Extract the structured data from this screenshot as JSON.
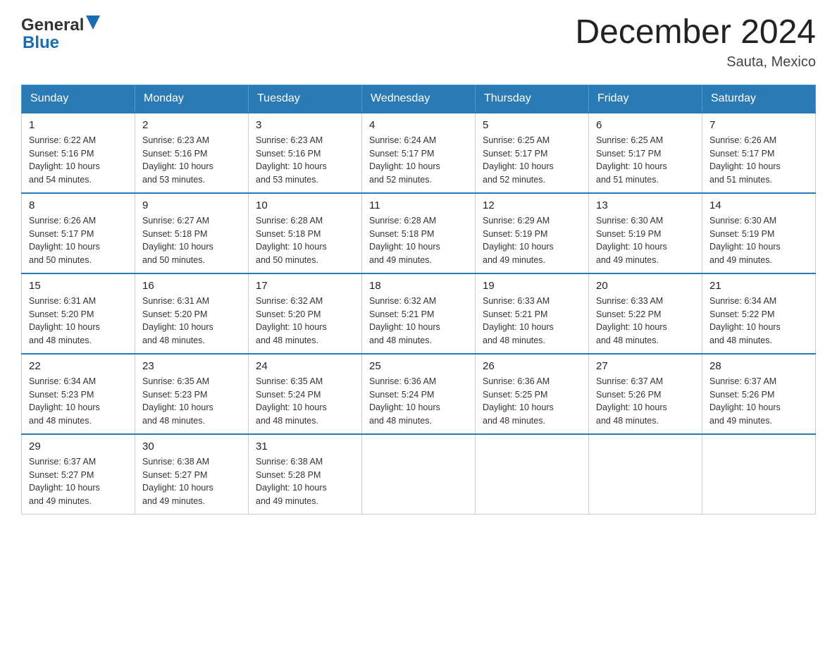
{
  "header": {
    "logo_general": "General",
    "logo_blue": "Blue",
    "title": "December 2024",
    "subtitle": "Sauta, Mexico"
  },
  "days_of_week": [
    "Sunday",
    "Monday",
    "Tuesday",
    "Wednesday",
    "Thursday",
    "Friday",
    "Saturday"
  ],
  "weeks": [
    [
      {
        "day": "1",
        "sunrise": "6:22 AM",
        "sunset": "5:16 PM",
        "daylight": "10 hours and 54 minutes."
      },
      {
        "day": "2",
        "sunrise": "6:23 AM",
        "sunset": "5:16 PM",
        "daylight": "10 hours and 53 minutes."
      },
      {
        "day": "3",
        "sunrise": "6:23 AM",
        "sunset": "5:16 PM",
        "daylight": "10 hours and 53 minutes."
      },
      {
        "day": "4",
        "sunrise": "6:24 AM",
        "sunset": "5:17 PM",
        "daylight": "10 hours and 52 minutes."
      },
      {
        "day": "5",
        "sunrise": "6:25 AM",
        "sunset": "5:17 PM",
        "daylight": "10 hours and 52 minutes."
      },
      {
        "day": "6",
        "sunrise": "6:25 AM",
        "sunset": "5:17 PM",
        "daylight": "10 hours and 51 minutes."
      },
      {
        "day": "7",
        "sunrise": "6:26 AM",
        "sunset": "5:17 PM",
        "daylight": "10 hours and 51 minutes."
      }
    ],
    [
      {
        "day": "8",
        "sunrise": "6:26 AM",
        "sunset": "5:17 PM",
        "daylight": "10 hours and 50 minutes."
      },
      {
        "day": "9",
        "sunrise": "6:27 AM",
        "sunset": "5:18 PM",
        "daylight": "10 hours and 50 minutes."
      },
      {
        "day": "10",
        "sunrise": "6:28 AM",
        "sunset": "5:18 PM",
        "daylight": "10 hours and 50 minutes."
      },
      {
        "day": "11",
        "sunrise": "6:28 AM",
        "sunset": "5:18 PM",
        "daylight": "10 hours and 49 minutes."
      },
      {
        "day": "12",
        "sunrise": "6:29 AM",
        "sunset": "5:19 PM",
        "daylight": "10 hours and 49 minutes."
      },
      {
        "day": "13",
        "sunrise": "6:30 AM",
        "sunset": "5:19 PM",
        "daylight": "10 hours and 49 minutes."
      },
      {
        "day": "14",
        "sunrise": "6:30 AM",
        "sunset": "5:19 PM",
        "daylight": "10 hours and 49 minutes."
      }
    ],
    [
      {
        "day": "15",
        "sunrise": "6:31 AM",
        "sunset": "5:20 PM",
        "daylight": "10 hours and 48 minutes."
      },
      {
        "day": "16",
        "sunrise": "6:31 AM",
        "sunset": "5:20 PM",
        "daylight": "10 hours and 48 minutes."
      },
      {
        "day": "17",
        "sunrise": "6:32 AM",
        "sunset": "5:20 PM",
        "daylight": "10 hours and 48 minutes."
      },
      {
        "day": "18",
        "sunrise": "6:32 AM",
        "sunset": "5:21 PM",
        "daylight": "10 hours and 48 minutes."
      },
      {
        "day": "19",
        "sunrise": "6:33 AM",
        "sunset": "5:21 PM",
        "daylight": "10 hours and 48 minutes."
      },
      {
        "day": "20",
        "sunrise": "6:33 AM",
        "sunset": "5:22 PM",
        "daylight": "10 hours and 48 minutes."
      },
      {
        "day": "21",
        "sunrise": "6:34 AM",
        "sunset": "5:22 PM",
        "daylight": "10 hours and 48 minutes."
      }
    ],
    [
      {
        "day": "22",
        "sunrise": "6:34 AM",
        "sunset": "5:23 PM",
        "daylight": "10 hours and 48 minutes."
      },
      {
        "day": "23",
        "sunrise": "6:35 AM",
        "sunset": "5:23 PM",
        "daylight": "10 hours and 48 minutes."
      },
      {
        "day": "24",
        "sunrise": "6:35 AM",
        "sunset": "5:24 PM",
        "daylight": "10 hours and 48 minutes."
      },
      {
        "day": "25",
        "sunrise": "6:36 AM",
        "sunset": "5:24 PM",
        "daylight": "10 hours and 48 minutes."
      },
      {
        "day": "26",
        "sunrise": "6:36 AM",
        "sunset": "5:25 PM",
        "daylight": "10 hours and 48 minutes."
      },
      {
        "day": "27",
        "sunrise": "6:37 AM",
        "sunset": "5:26 PM",
        "daylight": "10 hours and 48 minutes."
      },
      {
        "day": "28",
        "sunrise": "6:37 AM",
        "sunset": "5:26 PM",
        "daylight": "10 hours and 49 minutes."
      }
    ],
    [
      {
        "day": "29",
        "sunrise": "6:37 AM",
        "sunset": "5:27 PM",
        "daylight": "10 hours and 49 minutes."
      },
      {
        "day": "30",
        "sunrise": "6:38 AM",
        "sunset": "5:27 PM",
        "daylight": "10 hours and 49 minutes."
      },
      {
        "day": "31",
        "sunrise": "6:38 AM",
        "sunset": "5:28 PM",
        "daylight": "10 hours and 49 minutes."
      },
      null,
      null,
      null,
      null
    ]
  ],
  "labels": {
    "sunrise": "Sunrise:",
    "sunset": "Sunset:",
    "daylight": "Daylight:"
  }
}
